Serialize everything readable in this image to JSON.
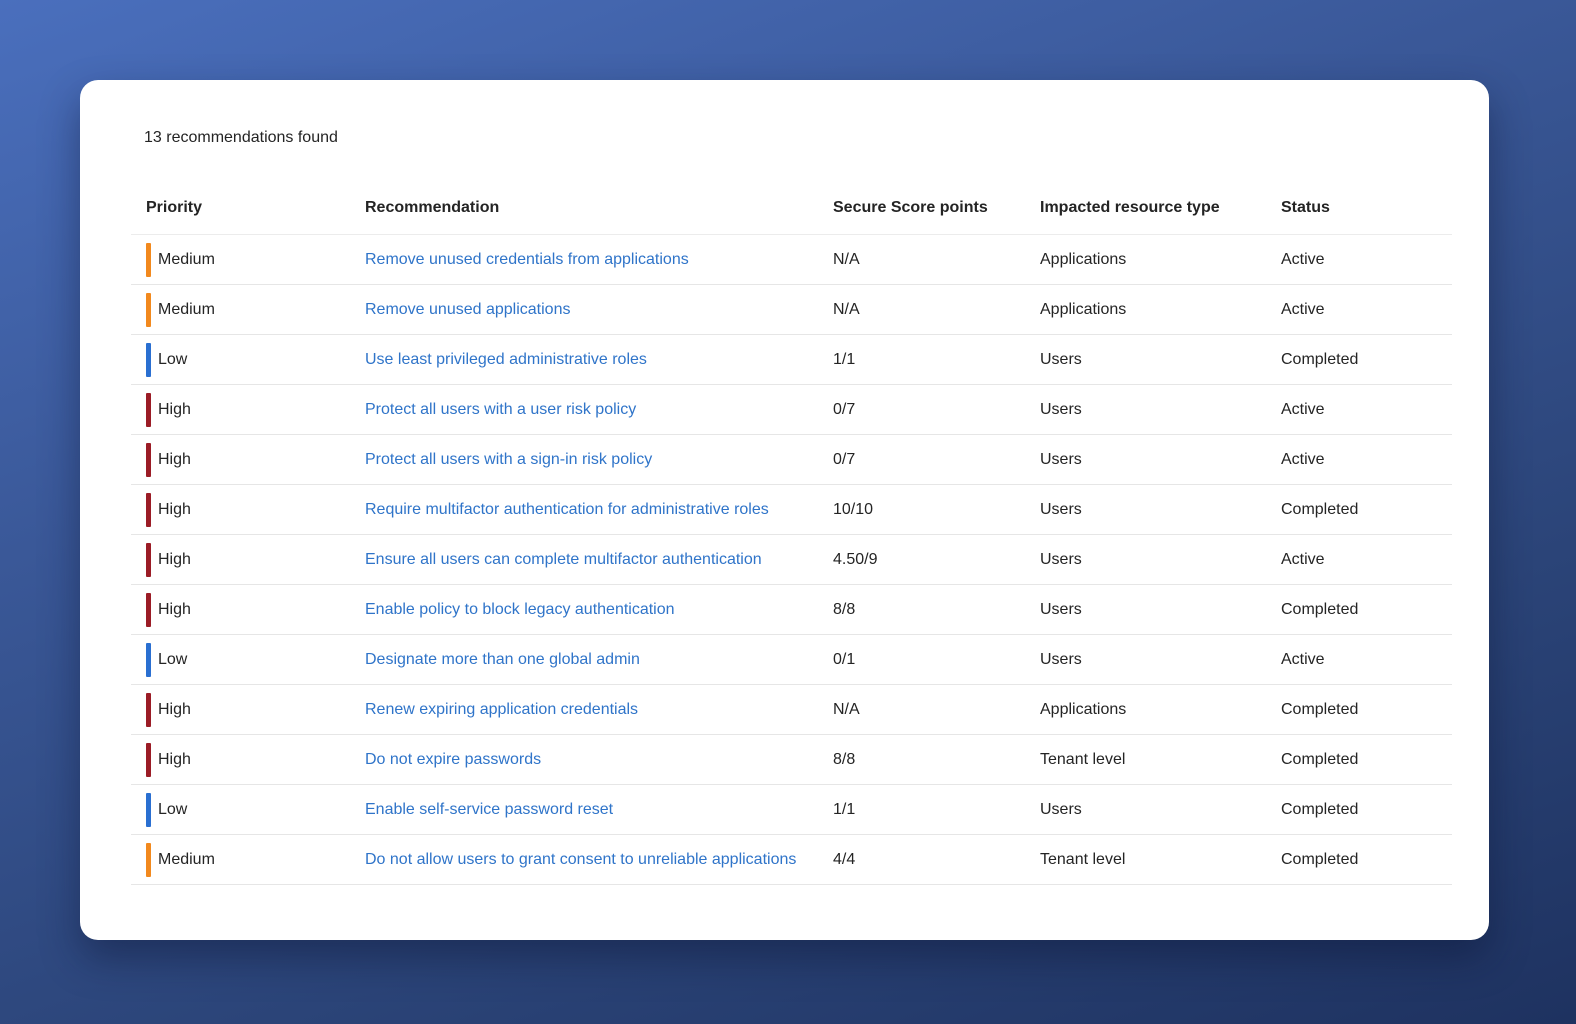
{
  "summary": {
    "count_text": "13 recommendations found"
  },
  "colors": {
    "High": "#9b1c26",
    "Medium": "#f2891d",
    "Low": "#2a6fd1",
    "link": "#2f74c9"
  },
  "table": {
    "headers": {
      "priority": "Priority",
      "recommendation": "Recommendation",
      "score": "Secure Score points",
      "type": "Impacted resource type",
      "status": "Status"
    },
    "rows": [
      {
        "priority": "Medium",
        "recommendation": "Remove unused credentials from applications",
        "score": "N/A",
        "type": "Applications",
        "status": "Active"
      },
      {
        "priority": "Medium",
        "recommendation": "Remove unused applications",
        "score": "N/A",
        "type": "Applications",
        "status": "Active"
      },
      {
        "priority": "Low",
        "recommendation": "Use least privileged administrative roles",
        "score": "1/1",
        "type": "Users",
        "status": "Completed"
      },
      {
        "priority": "High",
        "recommendation": "Protect all users with a user risk policy",
        "score": "0/7",
        "type": "Users",
        "status": "Active"
      },
      {
        "priority": "High",
        "recommendation": "Protect all users with a sign-in risk policy",
        "score": "0/7",
        "type": "Users",
        "status": "Active"
      },
      {
        "priority": "High",
        "recommendation": "Require multifactor authentication for administrative roles",
        "score": "10/10",
        "type": "Users",
        "status": "Completed"
      },
      {
        "priority": "High",
        "recommendation": "Ensure all users can complete multifactor authentication",
        "score": "4.50/9",
        "type": "Users",
        "status": "Active"
      },
      {
        "priority": "High",
        "recommendation": "Enable policy to block legacy authentication",
        "score": "8/8",
        "type": "Users",
        "status": "Completed"
      },
      {
        "priority": "Low",
        "recommendation": "Designate more than one global admin",
        "score": "0/1",
        "type": "Users",
        "status": "Active"
      },
      {
        "priority": "High",
        "recommendation": "Renew expiring application credentials",
        "score": "N/A",
        "type": "Applications",
        "status": "Completed"
      },
      {
        "priority": "High",
        "recommendation": "Do not expire passwords",
        "score": "8/8",
        "type": "Tenant level",
        "status": "Completed"
      },
      {
        "priority": "Low",
        "recommendation": "Enable self-service password reset",
        "score": "1/1",
        "type": "Users",
        "status": "Completed"
      },
      {
        "priority": "Medium",
        "recommendation": "Do not allow users to grant consent to unreliable applications",
        "score": "4/4",
        "type": "Tenant level",
        "status": "Completed"
      }
    ]
  }
}
